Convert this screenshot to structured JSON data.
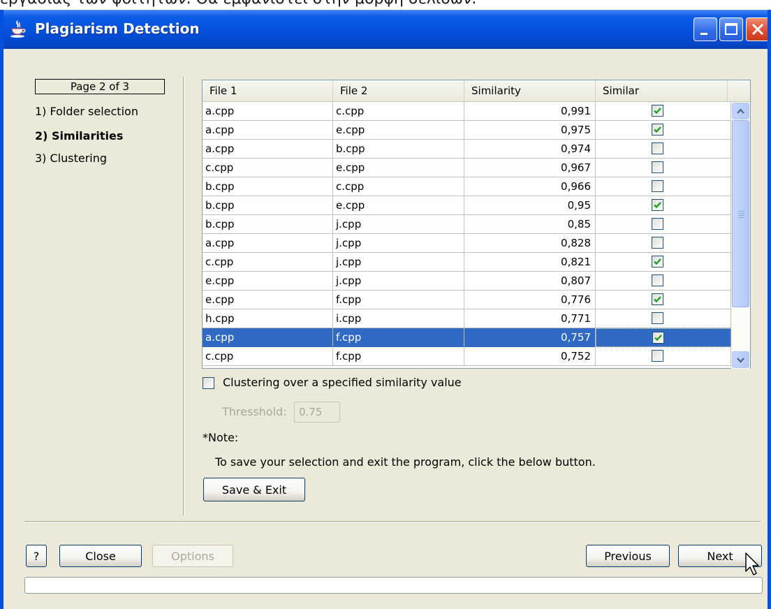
{
  "caption_above": "εργασίας των φοιτητών. Θα εμφανιστεί στην μορφή σελίδων.",
  "window": {
    "title": "Plagiarism Detection",
    "title_bar_color": "#0550dc"
  },
  "wizard": {
    "page_indicator": "Page 2 of 3",
    "steps": [
      {
        "label": "1) Folder selection",
        "current": false
      },
      {
        "label": "2) Similarities",
        "current": true
      },
      {
        "label": "3) Clustering",
        "current": false
      }
    ]
  },
  "table": {
    "columns": [
      "File 1",
      "File 2",
      "Similarity",
      "Similar"
    ],
    "rows": [
      {
        "file1": "a.cpp",
        "file2": "c.cpp",
        "similarity": "0,991",
        "similar": true
      },
      {
        "file1": "a.cpp",
        "file2": "e.cpp",
        "similarity": "0,975",
        "similar": true
      },
      {
        "file1": "a.cpp",
        "file2": "b.cpp",
        "similarity": "0,974",
        "similar": false
      },
      {
        "file1": "c.cpp",
        "file2": "e.cpp",
        "similarity": "0,967",
        "similar": false
      },
      {
        "file1": "b.cpp",
        "file2": "c.cpp",
        "similarity": "0,966",
        "similar": false
      },
      {
        "file1": "b.cpp",
        "file2": "e.cpp",
        "similarity": "0,95",
        "similar": true
      },
      {
        "file1": "b.cpp",
        "file2": "j.cpp",
        "similarity": "0,85",
        "similar": false
      },
      {
        "file1": "a.cpp",
        "file2": "j.cpp",
        "similarity": "0,828",
        "similar": false
      },
      {
        "file1": "c.cpp",
        "file2": "j.cpp",
        "similarity": "0,821",
        "similar": true
      },
      {
        "file1": "e.cpp",
        "file2": "j.cpp",
        "similarity": "0,807",
        "similar": false
      },
      {
        "file1": "e.cpp",
        "file2": "f.cpp",
        "similarity": "0,776",
        "similar": true
      },
      {
        "file1": "h.cpp",
        "file2": "i.cpp",
        "similarity": "0,771",
        "similar": false
      },
      {
        "file1": "a.cpp",
        "file2": "f.cpp",
        "similarity": "0,757",
        "similar": true,
        "selected": true
      },
      {
        "file1": "c.cpp",
        "file2": "f.cpp",
        "similarity": "0,752",
        "similar": false
      }
    ],
    "selection_color": "#316ac5",
    "check_color": "#21a121"
  },
  "clustering": {
    "checkbox_label": "Clustering over a specified similarity value",
    "checked": false,
    "threshold_label": "Thresshold:",
    "threshold_value": "0.75"
  },
  "note": {
    "title": "*Note:",
    "text": "To save your selection and exit the program, click the below button."
  },
  "buttons": {
    "save_exit": "Save & Exit",
    "help": "?",
    "close": "Close",
    "options": "Options",
    "previous": "Previous",
    "next": "Next"
  }
}
